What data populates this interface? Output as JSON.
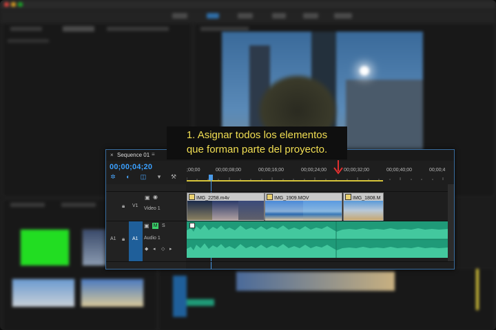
{
  "callout": {
    "line1": "1. Asignar todos los elementos",
    "line2": "que forman parte del proyecto.",
    "color": "#f2df53",
    "arrow_color": "#e03030"
  },
  "timeline": {
    "close_glyph": "×",
    "sequence_name": "Sequence 01",
    "menu_glyph": "≡",
    "timecode": "00;00;04;20",
    "ruler_ticks": [
      ";00;00",
      "00;00;08;00",
      "00;00;16;00",
      "00;00;24;00",
      "00;00;32;00",
      "00;00;40;00",
      "00;00;4"
    ],
    "tracks": {
      "v1_label": "V1",
      "video1_name": "Video 1",
      "a1_target": "A1",
      "a1_label": "A1",
      "audio1_name": "Audio 1",
      "mute": "M",
      "solo": "S"
    },
    "clips": [
      {
        "name": "IMG_2258.m4v"
      },
      {
        "name": "IMG_1909.MOV"
      },
      {
        "name": "IMG_1808.M"
      }
    ],
    "accent_color": "#3aa0ff",
    "audio_color": "#1f9a78",
    "playhead_color": "#4a9ae8"
  },
  "icons": [
    "snap-icon",
    "linked-selection-icon",
    "add-marker-icon",
    "marker-icon",
    "wrench-icon",
    "lock-icon",
    "eye-icon",
    "film-icon",
    "mic-icon",
    "keyframe-icon"
  ]
}
